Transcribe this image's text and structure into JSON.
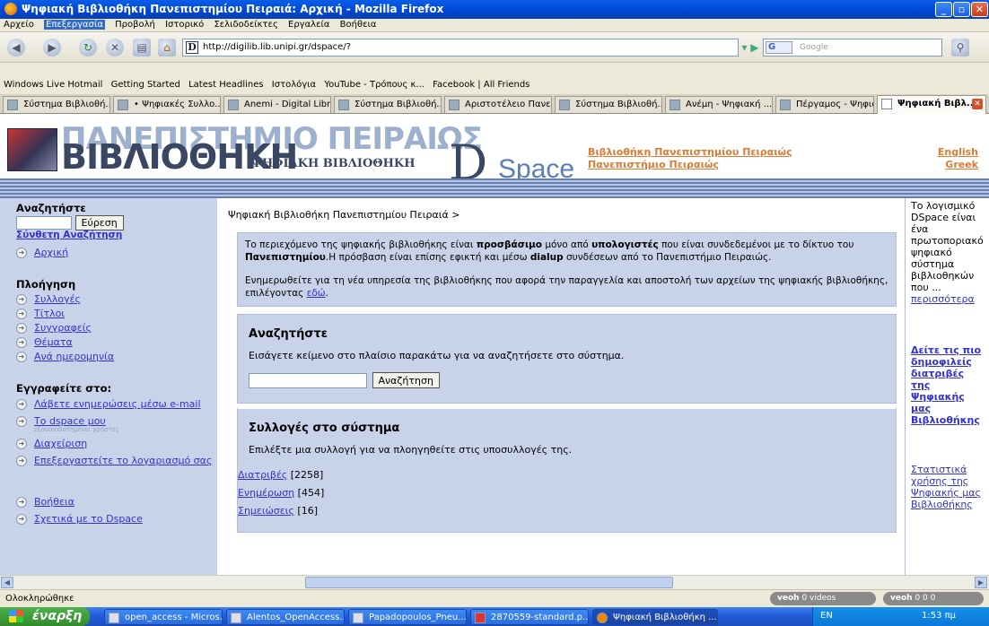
{
  "window": {
    "title": "Ψηφιακή Βιβλιοθήκη Πανεπιστημίου Πειραιά: Αρχική - Mozilla Firefox"
  },
  "menu": [
    "Αρχείο",
    "Επεξεργασία",
    "Προβολή",
    "Ιστορικό",
    "Σελιδοδείκτες",
    "Εργαλεία",
    "Βοήθεια"
  ],
  "toolbar": {
    "url": "http://digilib.lib.unipi.gr/dspace/?",
    "search_placeholder": "Google",
    "search_engine": "G"
  },
  "bookmarks": [
    "Windows Live Hotmail",
    "Getting Started",
    "Latest Headlines",
    "Ιστολόγια",
    "YouTube - Τρόπους κ...",
    "Facebook | All Friends"
  ],
  "tabs": [
    "Σύστημα Βιβλιοθή...",
    "• Ψηφιακές Συλλο...",
    "Anemi - Digital Libr...",
    "Σύστημα Βιβλιοθή...",
    "Αριστοτέλειο Πανε...",
    "Σύστημα Βιβλιοθή...",
    "Ανέμη - Ψηφιακή ...",
    "Πέργαμος - Ψηφια...",
    "Ψηφιακή Βιβλ..."
  ],
  "header": {
    "title_top": "ΠΑΝΕΠΙΣΤΗΜΙΟ ΠΕΙΡΑΙΩΣ",
    "title_main": "ΒΙΒΛΙΟΘΗΚΗ",
    "subtitle": "ΨΗΦΙΑΚΗ ΒΙΒΛΙΟΘΗΚΗ",
    "dspace_d": "D",
    "dspace_rest": "Space",
    "link_library": "Βιβλιοθήκη Πανεπιστημίου Πειραιώς",
    "link_university": "Πανεπιστήμιο Πειραιώς",
    "lang_en": "English",
    "lang_gr": "Greek"
  },
  "sidebar": {
    "search_heading": "Αναζητήστε",
    "search_button": "Εύρεση",
    "advanced": "Σύνθετη Αναζήτηση",
    "home": "Αρχική",
    "browse_heading": "Πλοήγηση",
    "browse": [
      "Συλλογές",
      "Τίτλοι",
      "Συγγραφείς",
      "Θέματα",
      "Ανά ημερομηνία"
    ],
    "subscribe_heading": "Εγγραφείτε στο:",
    "subscribe_email": "Λάβετε ενημερώσεις μέσω e-mail",
    "my_dspace": "Το dspace μου",
    "my_dspace_note": "εξουσιοδοτημένοι χρήστες",
    "admin": "Διαχείριση",
    "edit_profile": "Επεξεργαστείτε το λογαριασμό σας",
    "help": "Βοήθεια",
    "about": "Σχετικά με το Dspace"
  },
  "main": {
    "breadcrumb": "Ψηφιακή Βιβλιοθήκη Πανεπιστημίου Πειραιά >",
    "notice": {
      "p1a": "Το περιεχόμενο της ψηφιακής βιβλιοθήκης είναι ",
      "p1b": "προσβάσιμο",
      "p1c": " μόνο από ",
      "p1d": "υπολογιστές",
      "p1e": " που είναι συνδεδεμένοι με το δίκτυο του ",
      "p1f": "Πανεπιστημίου",
      "p1g": ".Η πρόσβαση είναι επίσης εφικτή και μέσω ",
      "p1h": "dialup",
      "p1i": " συνδέσεων από το Πανεπιστήμιο Πειραιώς.",
      "p2a": "Ενημερωθείτε για τη νέα υπηρεσία της βιβλιοθήκης που αφορά την παραγγελία και αποστολή των αρχείων της ψηφιακής βιβλιοθήκης, επιλέγοντας ",
      "p2link": "εδώ",
      "p2b": "."
    },
    "search": {
      "heading": "Αναζητήστε",
      "instruction": "Εισάγετε κείμενο στο πλαίσιο παρακάτω για να αναζητήσετε στο σύστημα.",
      "button": "Αναζήτηση"
    },
    "collections": {
      "heading": "Συλλογές στο σύστημα",
      "instruction": "Επιλέξτε μια συλλογή για να πλοηγηθείτε στις υποσυλλογές της.",
      "items": [
        {
          "name": "Διατριβές",
          "count": "[2258]"
        },
        {
          "name": "Ενημέρωση",
          "count": "[454]"
        },
        {
          "name": "Σημειώσεις",
          "count": "[16]"
        }
      ]
    }
  },
  "rightcol": {
    "about_text": "Το λογισμικό DSpace είναι ένα πρωτοποριακό ψηφιακό σύστημα βιβλιοθηκών που ...",
    "more": "περισσότερα",
    "popular": "Δείτε τις πιο δημοφιλείς διατριβές της Ψηφιακής μας Βιβλιοθήκης",
    "stats": "Στατιστικά χρήσης της Ψηφιακής μας Βιβλιοθήκης"
  },
  "status": {
    "text": "Ολοκληρώθηκε",
    "veoh1": "veoh",
    "veoh1_videos": "0 videos",
    "veoh2": "veoh",
    "veoh2_counts": "0  0  0"
  },
  "taskbar": {
    "start": "έναρξη",
    "items": [
      "open_access - Micros...",
      "Alentos_OpenAccess...",
      "Papadopoulos_Pneu...",
      "2870559-standard.p...",
      "Ψηφιακή Βιβλιοθήκη ..."
    ],
    "lang": "EN",
    "clock": "1:53 πμ"
  },
  "colors": {
    "sidebar_bg": "#c8d3ea",
    "link": "#3333cc",
    "accent_orange": "#e07a30",
    "navy": "#3a4763"
  }
}
